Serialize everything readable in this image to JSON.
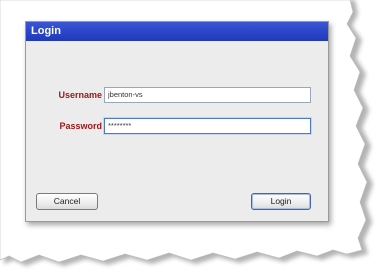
{
  "dialog": {
    "title": "Login",
    "username": {
      "label": "Username",
      "value": "jbenton-vs"
    },
    "password": {
      "label": "Password",
      "value": "********"
    },
    "cancel_label": "Cancel",
    "login_label": "Login"
  },
  "colors": {
    "titlebar": "#2a45c8",
    "label_text": "#a01818",
    "dialog_bg": "#ececec"
  }
}
